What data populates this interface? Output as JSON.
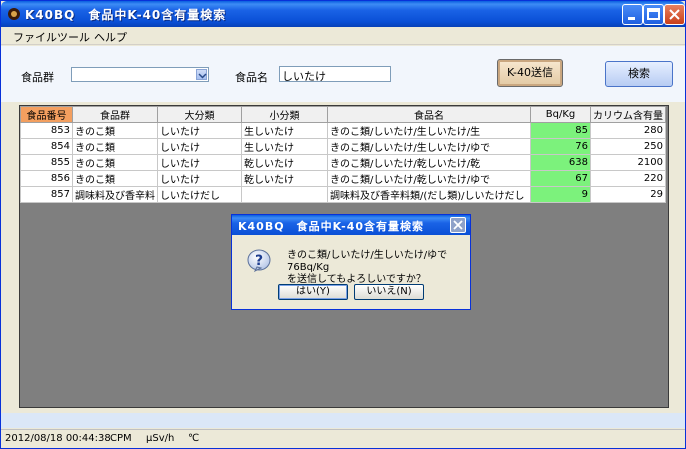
{
  "window": {
    "title": "K40BQ　食品中K-40含有量検索"
  },
  "menu": {
    "items": [
      "ファイル",
      "ツール",
      "ヘルプ"
    ]
  },
  "form": {
    "food_group_label": "食品群",
    "food_group_value": "",
    "food_name_label": "食品名",
    "food_name_value": "しいたけ",
    "send_button": "K-40送信",
    "search_button": "検索"
  },
  "table": {
    "columns": [
      "食品番号",
      "食品群",
      "大分類",
      "小分類",
      "食品名",
      "Bq/Kg",
      "カリウム含有量"
    ],
    "rows": [
      [
        "853",
        "きのこ類",
        "しいたけ",
        "生しいたけ",
        "きのこ類/しいたけ/生しいたけ/生",
        "85",
        "280"
      ],
      [
        "854",
        "きのこ類",
        "しいたけ",
        "生しいたけ",
        "きのこ類/しいたけ/生しいたけ/ゆで",
        "76",
        "250"
      ],
      [
        "855",
        "きのこ類",
        "しいたけ",
        "乾しいたけ",
        "きのこ類/しいたけ/乾しいたけ/乾",
        "638",
        "2100"
      ],
      [
        "856",
        "きのこ類",
        "しいたけ",
        "乾しいたけ",
        "きのこ類/しいたけ/乾しいたけ/ゆで",
        "67",
        "220"
      ],
      [
        "857",
        "調味料及び香辛料",
        "しいたけだし",
        "",
        "調味料及び香辛料類/(だし類)/しいたけだし",
        "9",
        "29"
      ]
    ]
  },
  "dialog": {
    "title": "K40BQ　食品中K-40含有量検索",
    "message_line1": "きのこ類/しいたけ/生しいたけ/ゆで 76Bq/Kg",
    "message_line2": "を送信してもよろしいですか？",
    "yes_button": "はい(Y)",
    "no_button": "いいえ(N)"
  },
  "status": {
    "datetime": "2012/08/18 00:44:38",
    "cpm": "CPM",
    "usvh": "μSv/h",
    "celsius": "℃"
  },
  "colors": {
    "title_blue": "#0a4fd6",
    "bq_highlight": "#7cf27c",
    "header_first": "#f39f5f"
  }
}
